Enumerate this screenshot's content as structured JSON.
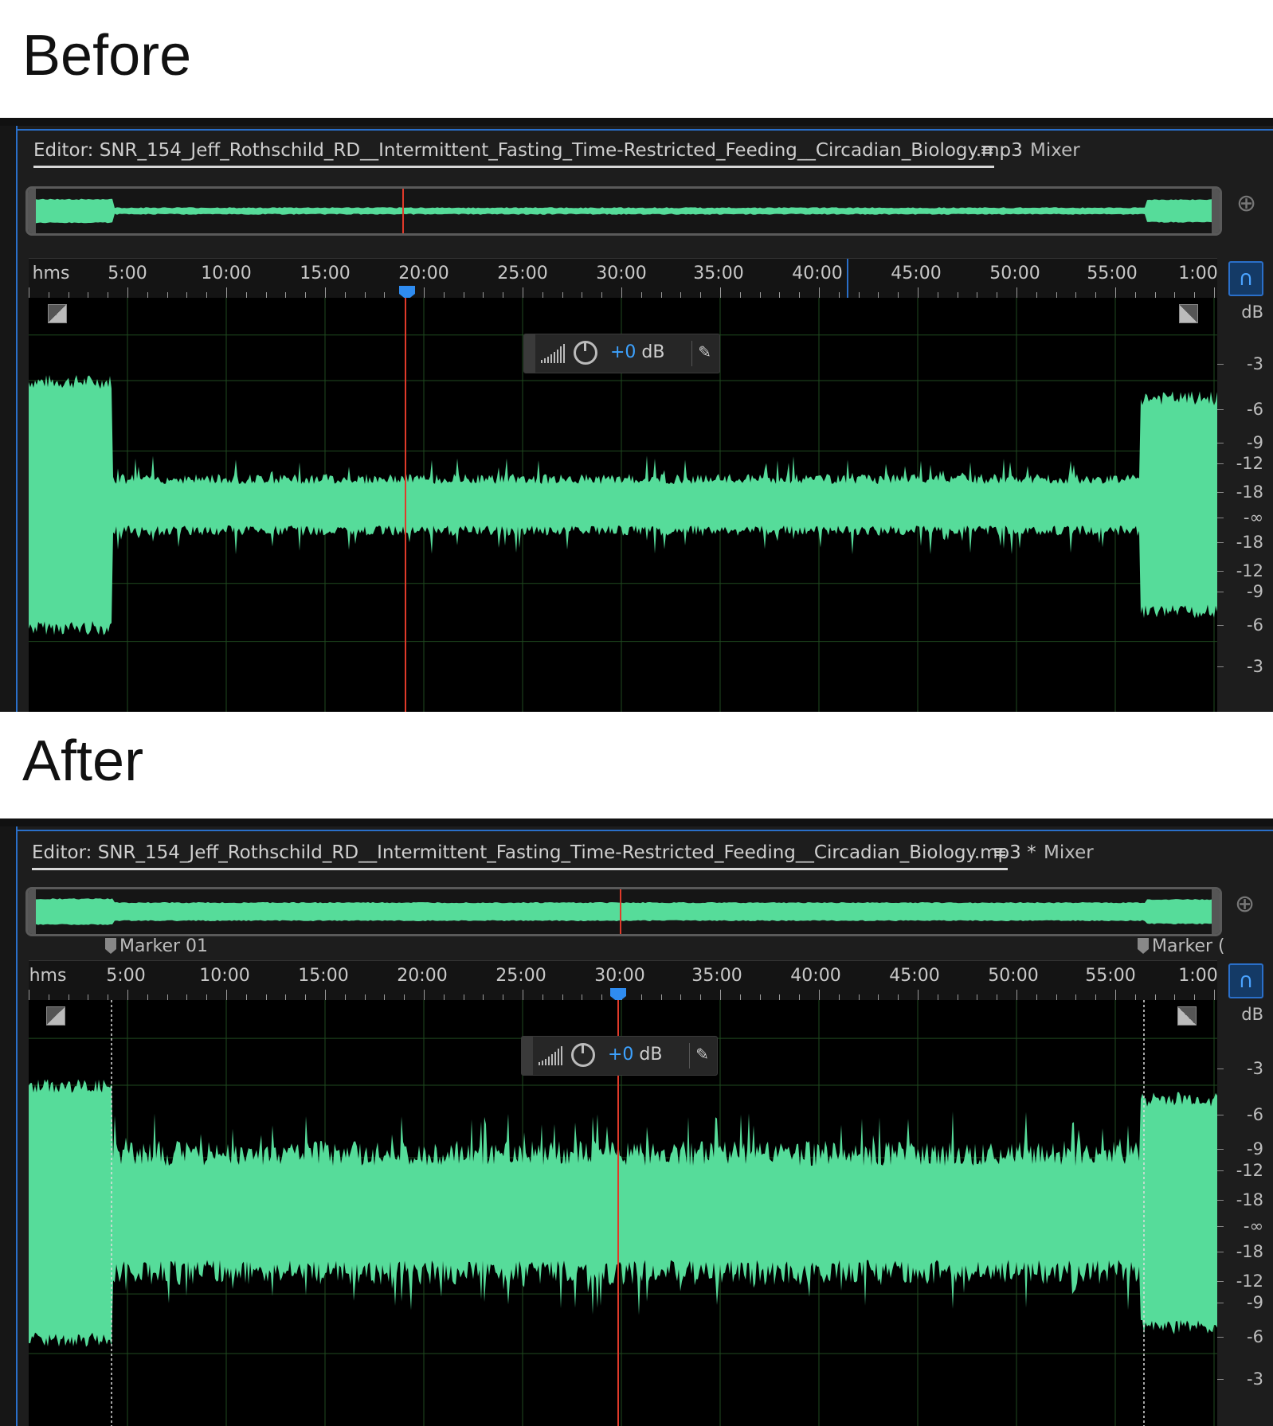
{
  "before": {
    "heading": "Before",
    "editor_tab": "Editor: SNR_154_Jeff_Rothschild_RD__Intermittent_Fasting_Time-Restricted_Feeding__Circadian_Biology.mp3",
    "menu_icon": "≡",
    "mixer_tab": "Mixer",
    "ruler_unit": "hms",
    "time_labels": [
      "5:00",
      "10:00",
      "15:00",
      "20:00",
      "25:00",
      "30:00",
      "35:00",
      "40:00",
      "45:00",
      "50:00",
      "55:00",
      "1:00"
    ],
    "hud_value": "+0",
    "hud_unit": " dB",
    "db_unit": "dB",
    "db_labels": [
      "-3",
      "-6",
      "-9",
      "-12",
      "-18",
      "-∞",
      "-18",
      "-12",
      "-9",
      "-6",
      "-3"
    ],
    "playhead_time": "19:00"
  },
  "after": {
    "heading": "After",
    "editor_tab": "Editor: SNR_154_Jeff_Rothschild_RD__Intermittent_Fasting_Time-Restricted_Feeding__Circadian_Biology.mp3 *",
    "menu_icon": "≡",
    "mixer_tab": "Mixer",
    "ruler_unit": "hms",
    "time_labels": [
      "5:00",
      "10:00",
      "15:00",
      "20:00",
      "25:00",
      "30:00",
      "35:00",
      "40:00",
      "45:00",
      "50:00",
      "55:00",
      "1:00"
    ],
    "markers": [
      "Marker 01",
      "Marker ("
    ],
    "hud_value": "+0",
    "hud_unit": " dB",
    "db_unit": "dB",
    "db_labels": [
      "-3",
      "-6",
      "-9",
      "-12",
      "-18",
      "-∞",
      "-18",
      "-12",
      "-9",
      "-6",
      "-3"
    ],
    "playhead_time": "30:00"
  },
  "colors": {
    "waveform": "#56dc9a",
    "playhead": "#e03a2a",
    "accent": "#2a6fc9",
    "gridline": "#1f4a1f"
  },
  "icons": [
    "menu-icon",
    "zoom-icon",
    "magnet-snap-icon",
    "fade-in-icon",
    "fade-out-icon",
    "volume-bars-icon",
    "volume-knob-icon",
    "pin-icon",
    "marker-flag-icon",
    "playhead-icon"
  ]
}
